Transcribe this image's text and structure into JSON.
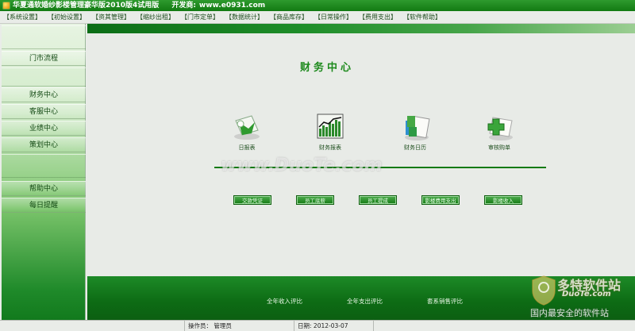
{
  "window": {
    "title": "华夏通软婚纱影楼管理豪华版2010版4试用版",
    "developer_label": "开发商:",
    "developer_url": "www.e0931.com"
  },
  "menu": {
    "items": [
      "【系统设置】",
      "【初始设置】",
      "【资其管理】",
      "【缩纱出租】",
      "【门市定单】",
      "【数据统计】",
      "【商品库存】",
      "【日常操作】",
      "【费用支出】",
      "【软件帮助】"
    ]
  },
  "sidebar": {
    "items": [
      "门市流程",
      "财务中心",
      "客服中心",
      "业绩中心",
      "策划中心",
      "帮助中心",
      "每日提醒"
    ]
  },
  "main": {
    "title": "财务中心",
    "tiles": [
      {
        "label": "日报表",
        "icon": "daily-report-icon"
      },
      {
        "label": "财务报表",
        "icon": "finance-chart-icon"
      },
      {
        "label": "财务日历",
        "icon": "finance-calendar-icon"
      },
      {
        "label": "审核购单",
        "icon": "audit-order-icon"
      }
    ],
    "actions": [
      "交款凭证",
      "员工底薪",
      "员工提成",
      "影楼费用支出",
      "影楼收入"
    ],
    "bottom_links": [
      "全年收入评比",
      "全年支出评比",
      "套系销售评比"
    ]
  },
  "statusbar": {
    "operator_label": "操作员：",
    "operator": "管理员",
    "date_label": "日期:",
    "date": "2012-03-07"
  },
  "watermarks": {
    "center": "www.DuoTe.com",
    "logo_cn": "多特软件站",
    "logo_en": "DuoTe.com",
    "logo_slogan": "国内最安全的软件站"
  },
  "colors": {
    "brand_green": "#127a12",
    "title_green": "#1d8a1d"
  }
}
